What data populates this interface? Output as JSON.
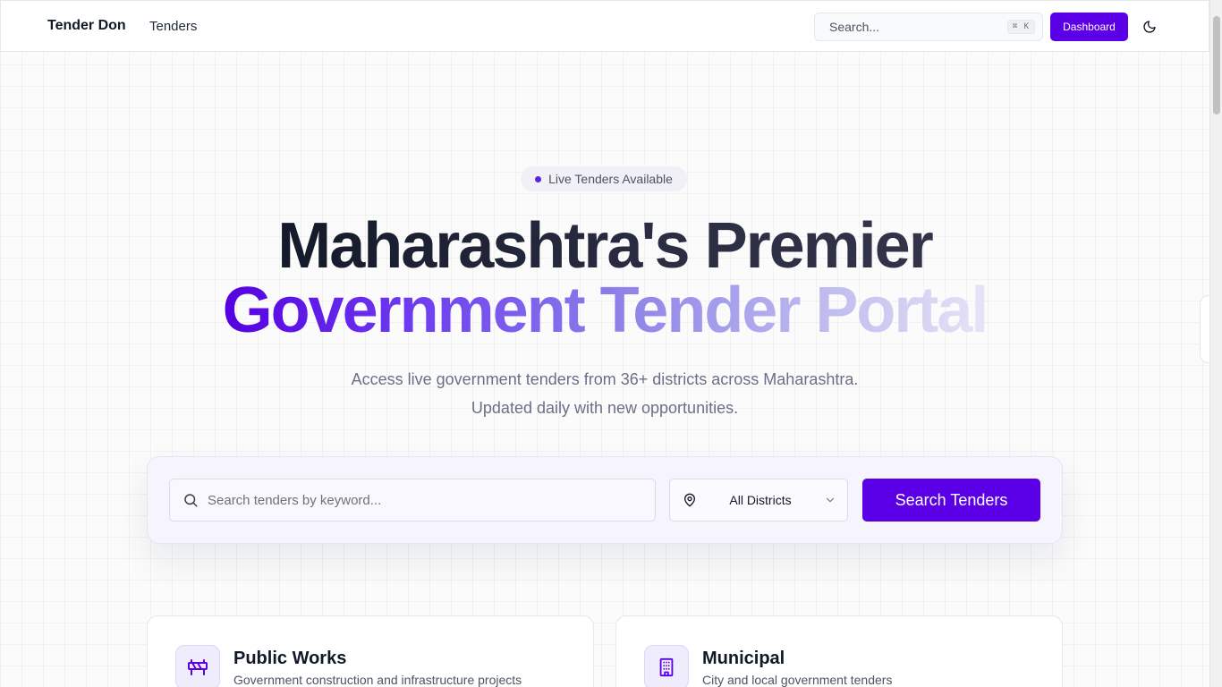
{
  "header": {
    "brand": "Tender Don",
    "nav": {
      "tenders": "Tenders"
    },
    "search": {
      "placeholder": "Search...",
      "shortcut": "⌘ K"
    },
    "dashboard_label": "Dashboard",
    "theme_icon": "moon-icon"
  },
  "hero": {
    "badge": "Live Tenders Available",
    "title_line1": "Maharashtra's Premier",
    "title_line2": "Government Tender Portal",
    "subtitle_line1": "Access live government tenders from 36+ districts across Maharashtra.",
    "subtitle_line2": "Updated daily with new opportunities."
  },
  "search_panel": {
    "keyword_placeholder": "Search tenders by keyword...",
    "district_value": "All Districts",
    "button_label": "Search Tenders"
  },
  "categories": [
    {
      "title": "Public Works",
      "desc": "Government construction and infrastructure projects",
      "icon": "construction-barrier-icon"
    },
    {
      "title": "Municipal",
      "desc": "City and local government tenders",
      "icon": "building-icon"
    }
  ],
  "colors": {
    "accent": "#5b00e6",
    "gradient_start": "#5500e0",
    "gradient_end": "#e6e4f6"
  }
}
